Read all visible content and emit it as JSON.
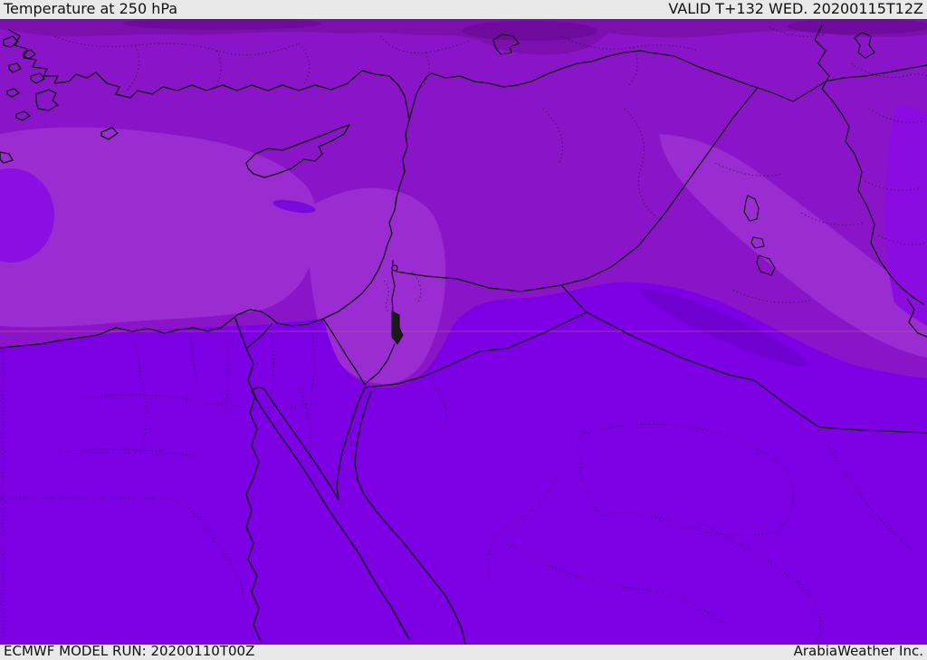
{
  "header": {
    "title": "Temperature at 250 hPa",
    "valid_label": "VALID T+132 WED. 20200115T12Z"
  },
  "footer": {
    "model_run_label": "ECMWF MODEL RUN: 20200110T00Z",
    "provider_label": "ArabiaWeather Inc."
  },
  "map": {
    "description": "Filled temperature contour field at 250 hPa over the Middle East and Eastern Mediterranean",
    "colors": {
      "bar_bg": "#e9e9e9",
      "bar_text": "#111111",
      "field_upper": "#8a14c8",
      "field_lower": "#7c00e3",
      "field_light": "#9a2cd2",
      "field_top_band": "#7c10ae",
      "field_top_dark": "#6e0b9c",
      "field_left_blob": "#8a0fe0",
      "field_med_ellipse": "#7a0adc",
      "field_dark_streak": "#6f00cf",
      "field_right_strip": "#8b0ce0",
      "border_line": "#0b0b0b",
      "admin_line": "#2d1136",
      "gridline": "#c06a8a",
      "dead_sea_fill": "#1a1a1a"
    }
  }
}
